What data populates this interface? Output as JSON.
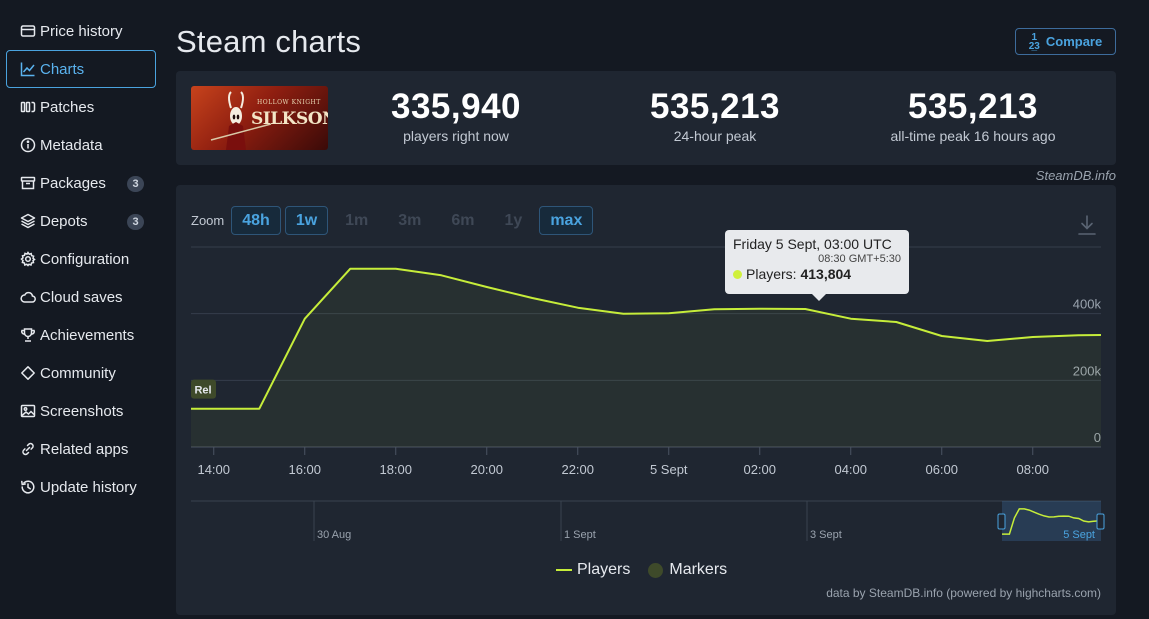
{
  "sidebar": {
    "items": [
      {
        "label": "Price history",
        "icon": "price-history-icon"
      },
      {
        "label": "Charts",
        "icon": "chart-line-icon",
        "active": true
      },
      {
        "label": "Patches",
        "icon": "patches-icon"
      },
      {
        "label": "Metadata",
        "icon": "info-icon"
      },
      {
        "label": "Packages",
        "icon": "package-icon",
        "badge": "3"
      },
      {
        "label": "Depots",
        "icon": "layers-icon",
        "badge": "3"
      },
      {
        "label": "Configuration",
        "icon": "gear-icon"
      },
      {
        "label": "Cloud saves",
        "icon": "cloud-icon"
      },
      {
        "label": "Achievements",
        "icon": "trophy-icon"
      },
      {
        "label": "Community",
        "icon": "diamond-icon"
      },
      {
        "label": "Screenshots",
        "icon": "image-icon"
      },
      {
        "label": "Related apps",
        "icon": "link-icon"
      },
      {
        "label": "Update history",
        "icon": "history-icon"
      }
    ]
  },
  "header": {
    "title": "Steam charts",
    "compare_label": "Compare",
    "compare_icon": "1\n2̲ 3"
  },
  "stats": {
    "capsule_top": "HOLLOW KNIGHT",
    "capsule_title": "SILKSONG",
    "players_now": {
      "value": "335,940",
      "label": "players right now"
    },
    "peak_24h": {
      "value": "535,213",
      "label": "24-hour peak"
    },
    "peak_all": {
      "value": "535,213",
      "label": "all-time peak 16 hours ago"
    },
    "credit": "SteamDB.info"
  },
  "zoom": {
    "label": "Zoom",
    "buttons": [
      {
        "label": "48h",
        "active": true
      },
      {
        "label": "1w",
        "active": true
      },
      {
        "label": "1m",
        "active": false
      },
      {
        "label": "3m",
        "active": false
      },
      {
        "label": "6m",
        "active": false
      },
      {
        "label": "1y",
        "active": false
      },
      {
        "label": "max",
        "active": true
      }
    ]
  },
  "tooltip": {
    "title": "Friday 5 Sept, 03:00 UTC",
    "subtitle": "08:30 GMT+5:30",
    "series": "Players: ",
    "value": "413,804"
  },
  "marker_label": "Rel",
  "legend": {
    "players": "Players",
    "markers": "Markers"
  },
  "data_credit": "data by SteamDB.info (powered by highcharts.com)",
  "colors": {
    "line": "#c6ed3a",
    "accent": "#4aa3df",
    "panel": "#1f2631",
    "bg": "#141922"
  },
  "chart_data": {
    "type": "line",
    "series": [
      {
        "name": "Players",
        "x": [
          13.5,
          14,
          15,
          16,
          17,
          18,
          19,
          20,
          21,
          22,
          23,
          24,
          25,
          26,
          27,
          28,
          29,
          30,
          31,
          32,
          33,
          33.5
        ],
        "values": [
          115000,
          115000,
          115000,
          385000,
          535000,
          535000,
          515000,
          480000,
          447000,
          418000,
          400000,
          401000,
          413000,
          415000,
          414000,
          385000,
          375000,
          333000,
          318000,
          330000,
          335000,
          336000
        ]
      }
    ],
    "x_tick_values": [
      14,
      16,
      18,
      20,
      22,
      24,
      26,
      28,
      30,
      32
    ],
    "x_tick_labels": [
      "14:00",
      "16:00",
      "18:00",
      "20:00",
      "22:00",
      "5 Sept",
      "02:00",
      "04:00",
      "06:00",
      "08:00"
    ],
    "xlim": [
      13.5,
      33.5
    ],
    "y_ticks": [
      0,
      200000,
      400000
    ],
    "y_tick_labels": [
      "0",
      "200k",
      "400k"
    ],
    "ylim": [
      0,
      600000
    ],
    "grid": true,
    "navigator_labels": [
      "30 Aug",
      "1 Sept",
      "3 Sept",
      "5 Sept"
    ]
  }
}
